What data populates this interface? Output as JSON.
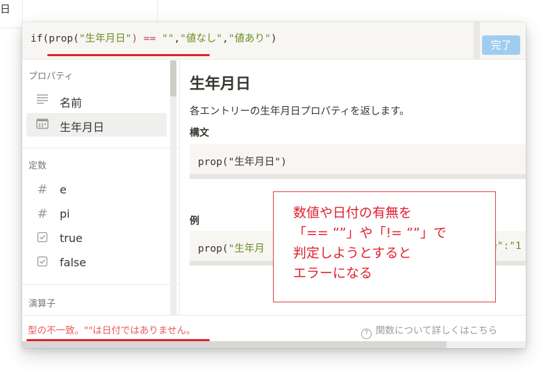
{
  "background": {
    "partial_text": "日"
  },
  "editor": {
    "formula_parts": {
      "p1": "if(prop(",
      "p2": "\"生年月日\"",
      "p3": ") == ",
      "p4": "\"\"",
      "p5": ",",
      "p6": "\"値なし\"",
      "p7": ",",
      "p8": "\"値あり\"",
      "p9": ")"
    },
    "done_label": "完了"
  },
  "sidebar": {
    "sections": [
      {
        "title": "プロパティ",
        "items": [
          {
            "icon": "text-lines-icon",
            "label": "名前"
          },
          {
            "icon": "calendar-icon",
            "label": "生年月日",
            "active": true
          }
        ]
      },
      {
        "title": "定数",
        "items": [
          {
            "icon": "hash-icon",
            "label": "e"
          },
          {
            "icon": "hash-icon",
            "label": "pi"
          },
          {
            "icon": "checkbox-icon",
            "label": "true"
          },
          {
            "icon": "checkbox-icon",
            "label": "false"
          }
        ]
      },
      {
        "title": "演算子"
      }
    ]
  },
  "panel": {
    "title": "生年月日",
    "description": "各エントリーの生年月日プロパティを返します。",
    "syntax_heading": "構文",
    "syntax_code_a": "prop(",
    "syntax_code_b": "\"生年月日\"",
    "syntax_code_c": ")",
    "example_heading": "例",
    "example_code_a": "prop(",
    "example_code_b": "\"生年月",
    "example_code_c": "e\":\"1"
  },
  "footer": {
    "error": "型の不一致。\"\"は日付ではありません。",
    "help": "関数について詳しくはこちら"
  },
  "annotation": {
    "text": "数値や日付の有無を\n「== ””」や「!= ””」で\n判定しようとすると\nエラーになる"
  },
  "colors": {
    "accent_red": "#e0202e",
    "error_text": "#eb5757",
    "string_green": "#6b8e23",
    "done_button": "#9fcdf0"
  }
}
